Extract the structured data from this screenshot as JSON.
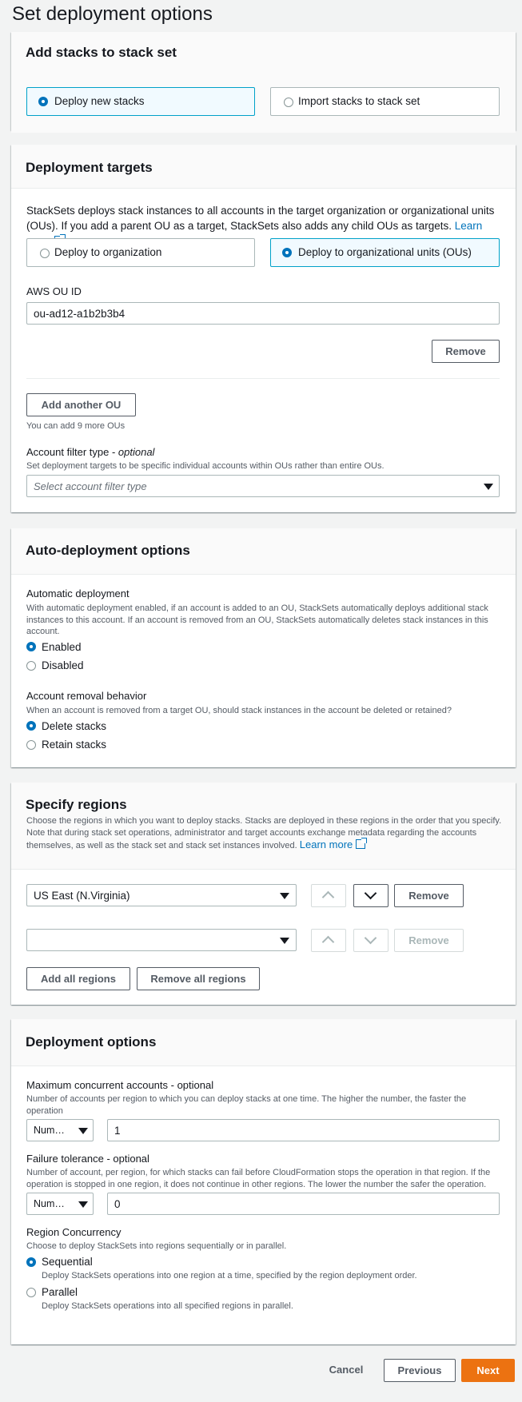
{
  "page": {
    "title": "Set deployment options"
  },
  "add_stacks": {
    "title": "Add stacks to stack set",
    "options": [
      "Deploy new stacks",
      "Import stacks to stack set"
    ]
  },
  "deployment_targets": {
    "title": "Deployment targets",
    "description_line1": "StackSets deploys stack instances to all accounts in the target organization or organizational units",
    "description_line2": "(OUs). If you add a parent OU as a target, StackSets also adds any child OUs as targets.",
    "learn_more": "Learn more",
    "options": [
      "Deploy to organization",
      "Deploy to organizational units (OUs)"
    ],
    "ou_label": "AWS OU ID",
    "ou_value": "ou-ad12-a1b2b3b4",
    "remove_label": "Remove",
    "add_ou_label": "Add another OU",
    "ou_hint": "You can add 9 more OUs",
    "filter_label": "Account filter type -",
    "filter_optional": "optional",
    "filter_desc": "Set deployment targets to be specific individual accounts within OUs rather than entire OUs.",
    "filter_placeholder": "Select account filter type"
  },
  "auto_deploy": {
    "title": "Auto-deployment options",
    "auto_label": "Automatic deployment",
    "auto_desc_1": "With automatic deployment enabled, if an account is added to an OU, StackSets automatically deploys additional stack",
    "auto_desc_2": "instances to this account. If an account is removed from an OU, StackSets automatically deletes stack instances in this",
    "auto_desc_3": "account.",
    "enabled": "Enabled",
    "disabled": "Disabled",
    "removal_label": "Account removal behavior",
    "removal_desc": "When an account is removed from a target OU, should stack instances in the account be deleted or retained?",
    "delete": "Delete stacks",
    "retain": "Retain stacks"
  },
  "regions": {
    "title": "Specify regions",
    "desc_1": "Choose the regions in which you want to deploy stacks. Stacks are deployed in these regions in the order that you specify.",
    "desc_2": "Note that during stack set operations, administrator and target accounts exchange metadata regarding the accounts",
    "desc_3": "themselves, as well as the stack set and stack set instances involved.",
    "learn_more": "Learn more",
    "region_1": "US East (N.Virginia)",
    "region_2": "",
    "remove_label": "Remove",
    "add_all": "Add all regions",
    "remove_all": "Remove all regions"
  },
  "deploy_options": {
    "title": "Deployment options",
    "max_label": "Maximum concurrent accounts - optional",
    "max_desc_1": "Number of accounts per region to which you can deploy stacks at one time. The higher the number, the faster the",
    "max_desc_2": "operation",
    "max_type": "Num…",
    "max_value": "1",
    "fail_label": "Failure tolerance - optional",
    "fail_desc_1": "Number of account, per region, for which stacks can fail before CloudFormation stops the operation in that region. If the",
    "fail_desc_2": "operation is stopped in one region, it does not continue in other regions. The lower the number the safer the operation.",
    "fail_type": "Num…",
    "fail_value": "0",
    "concurrency_label": "Region Concurrency",
    "concurrency_desc": "Choose to deploy StackSets into regions sequentially or in parallel.",
    "sequential": "Sequential",
    "sequential_desc": "Deploy StackSets operations into one region at a time, specified by the region deployment order.",
    "parallel": "Parallel",
    "parallel_desc": "Deploy StackSets operations into all specified regions in parallel."
  },
  "footer": {
    "cancel": "Cancel",
    "previous": "Previous",
    "next": "Next"
  },
  "colors": {
    "accent": "#0073bb",
    "primary_button": "#ec7211",
    "selected_tile": "#00a1c9"
  }
}
